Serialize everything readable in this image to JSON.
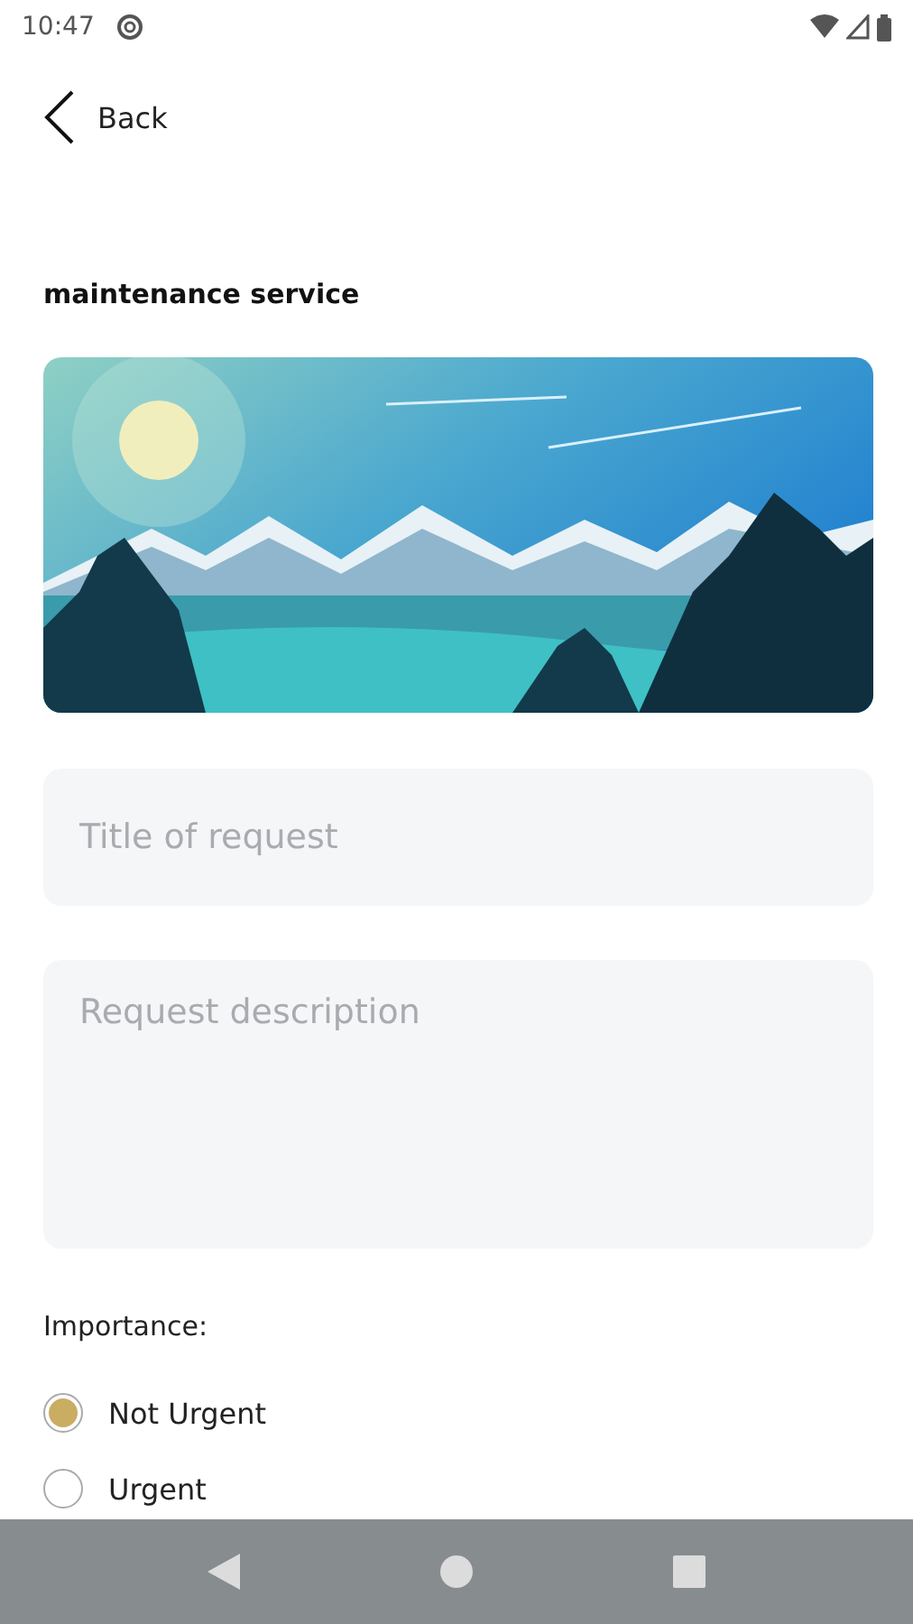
{
  "status_bar": {
    "time": "10:47"
  },
  "back": {
    "label": "Back"
  },
  "title": "maintenance service",
  "fields": [
    {
      "kind": "line",
      "placeholder": "Title of request"
    },
    {
      "kind": "area",
      "placeholder": "Request description"
    }
  ],
  "importance": {
    "label": "Importance:",
    "options": [
      {
        "label": "Not Urgent",
        "selected": true
      },
      {
        "label": "Urgent",
        "selected": false
      }
    ]
  }
}
